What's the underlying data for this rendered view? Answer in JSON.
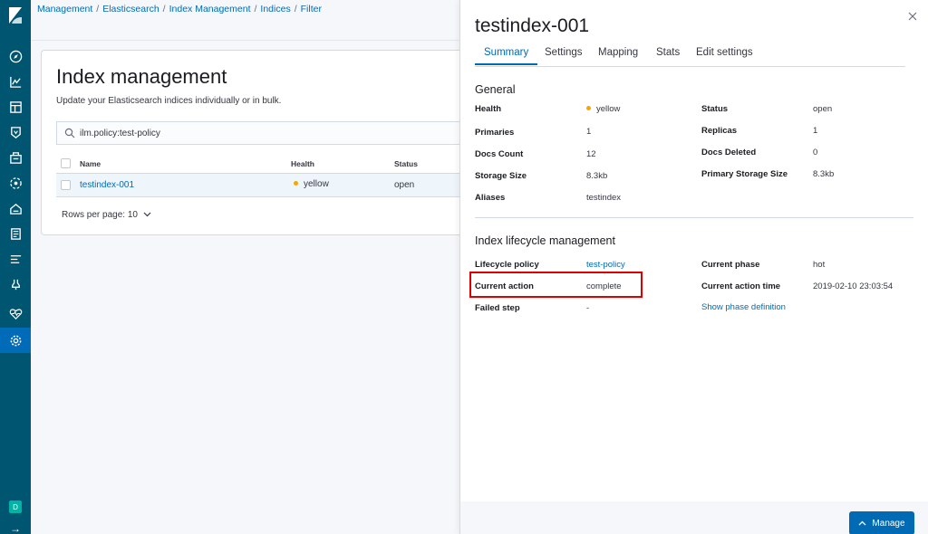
{
  "breadcrumbs": [
    "Management",
    "Elasticsearch",
    "Index Management",
    "Indices",
    "Filter"
  ],
  "nav": {
    "avatar_label": "D",
    "icons": [
      "compass-icon",
      "visualize-icon",
      "dashboard-icon",
      "canvas-icon",
      "maps-icon",
      "ml-icon",
      "infrastructure-icon",
      "logs-icon",
      "apm-icon",
      "devtools-icon",
      "monitoring-icon",
      "gear-icon"
    ]
  },
  "main": {
    "title": "Index management",
    "description": "Update your Elasticsearch indices individually or in bulk.",
    "search_value": "ilm.policy:test-policy",
    "table": {
      "columns": [
        "Name",
        "Health",
        "Status"
      ],
      "rows": [
        {
          "name": "testindex-001",
          "health": "yellow",
          "status": "open"
        }
      ]
    },
    "rows_per_page": "Rows per page: 10"
  },
  "flyout": {
    "title": "testindex-001",
    "tabs": [
      "Summary",
      "Settings",
      "Mapping",
      "Stats",
      "Edit settings"
    ],
    "active_tab": "Summary",
    "general": {
      "title": "General",
      "health_label": "Health",
      "health_value": "yellow",
      "status_label": "Status",
      "status_value": "open",
      "primaries_label": "Primaries",
      "primaries_value": "1",
      "replicas_label": "Replicas",
      "replicas_value": "1",
      "docs_count_label": "Docs Count",
      "docs_count_value": "12",
      "docs_deleted_label": "Docs Deleted",
      "docs_deleted_value": "0",
      "storage_size_label": "Storage Size",
      "storage_size_value": "8.3kb",
      "primary_storage_label": "Primary Storage Size",
      "primary_storage_value": "8.3kb",
      "aliases_label": "Aliases",
      "aliases_value": "testindex"
    },
    "ilm": {
      "title": "Index lifecycle management",
      "policy_label": "Lifecycle policy",
      "policy_value": "test-policy",
      "phase_label": "Current phase",
      "phase_value": "hot",
      "action_label": "Current action",
      "action_value": "complete",
      "action_time_label": "Current action time",
      "action_time_value": "2019-02-10 23:03:54",
      "failed_label": "Failed step",
      "failed_value": "-",
      "show_phase_link": "Show phase definition"
    },
    "manage_label": "Manage"
  },
  "colors": {
    "nav_bg": "#005571",
    "accent": "#006bb4",
    "health_yellow": "#f5a700",
    "highlight": "#e00000"
  }
}
